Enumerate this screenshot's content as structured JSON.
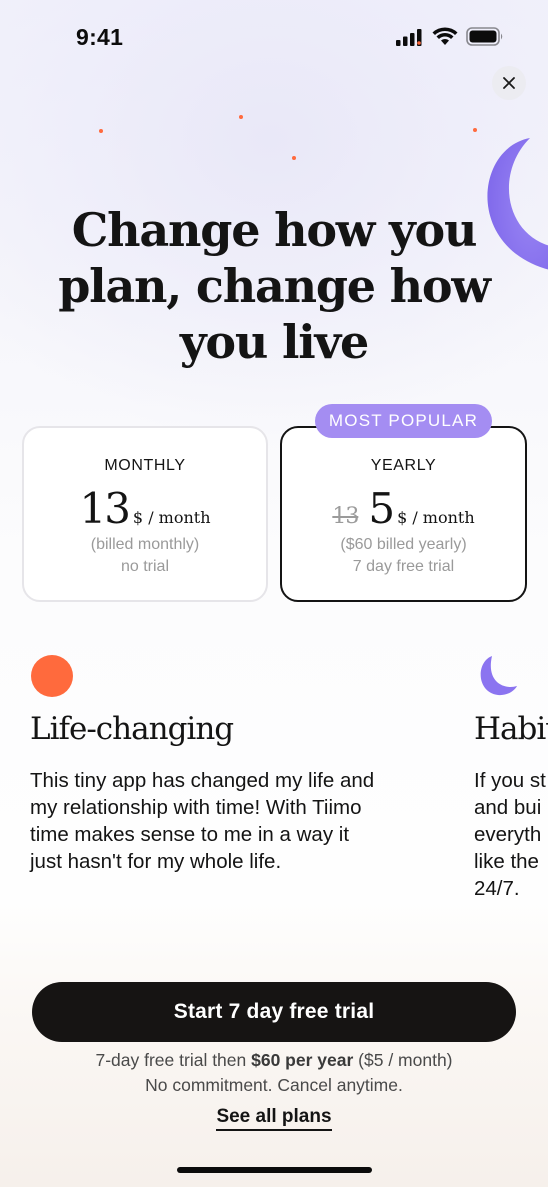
{
  "status_bar": {
    "time": "9:41"
  },
  "headline": {
    "line1": "Change how you",
    "line2": "plan, change how",
    "line3": "you live"
  },
  "plans": {
    "badge": "MOST POPULAR",
    "monthly": {
      "label": "MONTHLY",
      "price": "13",
      "unit": "$ / month",
      "billed": "(billed monthly)",
      "trial": "no trial"
    },
    "yearly": {
      "label": "YEARLY",
      "old_price": "13",
      "price": "5",
      "unit": "$ / month",
      "billed": "($60 billed yearly)",
      "trial": "7 day free trial"
    }
  },
  "testimonials": [
    {
      "title": "Life-changing",
      "icon": "orange-circle-icon",
      "body": [
        "This tiny app has changed my life and",
        "my relationship with time! With Tiimo",
        "time makes sense to me in a way it",
        "just hasn't for my whole life."
      ]
    },
    {
      "title": "Habit",
      "icon": "purple-moon-icon",
      "body": [
        "If you st",
        "and bui",
        "everyth",
        "like the",
        "24/7."
      ]
    }
  ],
  "cta": {
    "label": "Start 7 day free trial"
  },
  "fine_print": {
    "prefix": "7-day free trial then ",
    "bold": "$60 per year",
    "suffix": " ($5 / month)",
    "line2": "No commitment. Cancel anytime."
  },
  "see_all": "See all plans",
  "colors": {
    "accent_purple": "#a48df2",
    "moon_purple": "#8b74f0",
    "orange": "#ff6a3d",
    "cta_bg": "#161413"
  }
}
